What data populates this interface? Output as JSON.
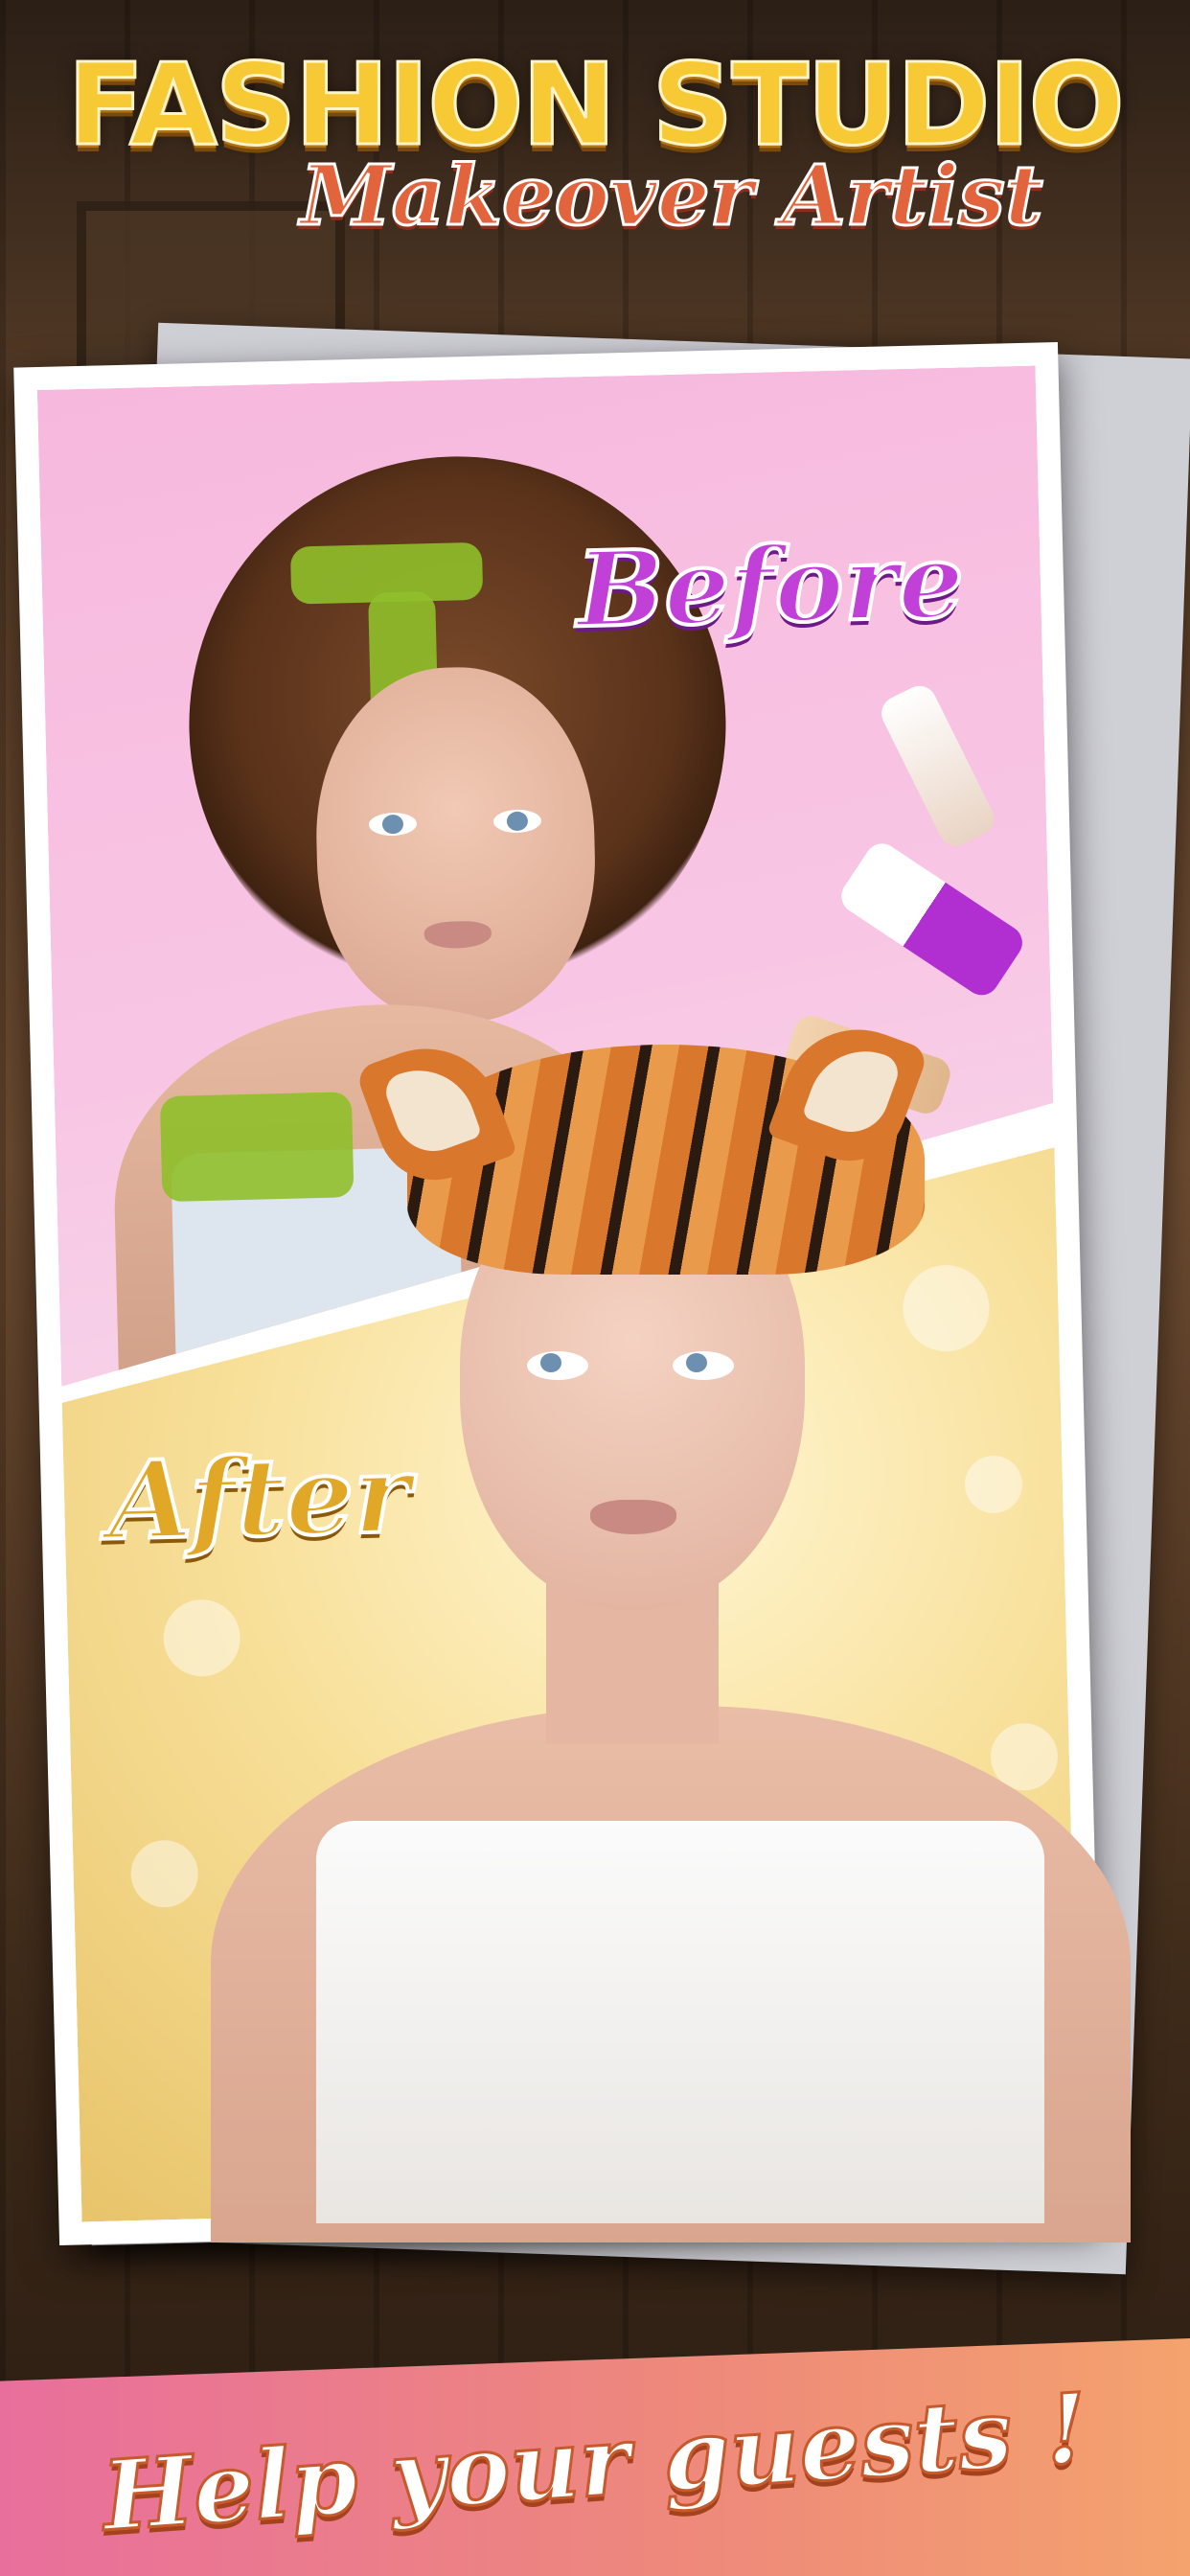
{
  "app": {
    "title_line1": "FASHION STUDIO",
    "title_line2": "Makeover Artist"
  },
  "comparison": {
    "before_label": "Before",
    "after_label": "After"
  },
  "banner": {
    "tagline": "Help your guests !"
  },
  "colors": {
    "title_gold": "#f7c934",
    "subtitle_orange": "#e2643c",
    "before_purple": "#c040d8",
    "after_gold": "#e0a826",
    "before_bg_pink": "#f7b8de",
    "after_bg_yellow": "#f8e09a",
    "banner_pink": "#e86f9c",
    "banner_orange": "#f4a26e"
  }
}
